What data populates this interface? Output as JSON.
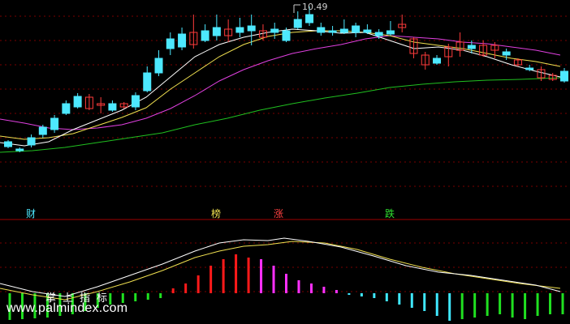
{
  "colors": {
    "background": "#000000",
    "grid": "#7a0000",
    "separator": "#a00000",
    "up": "#ff3b3b",
    "down": "#4de8ff",
    "ma5": "#ffffff",
    "ma10": "#f0e050",
    "ma20": "#e040e0",
    "ma60": "#20c020",
    "hist_red": "#ff1a1a",
    "hist_magenta": "#ff30ff",
    "hist_cyan": "#40e8ff",
    "hist_green": "#20e020"
  },
  "annotations": {
    "high_label": "10.49",
    "signal_cai": "财",
    "signal_bang": "榜",
    "signal_zhang": "涨",
    "signal_die": "跌",
    "indicator_name": "掌上指标",
    "watermark": "www.palmindex.com"
  },
  "chart_data": [
    {
      "type": "candlestick",
      "title": "",
      "high_marker": 10.49,
      "candles": [
        [
          175,
          181,
          173,
          183
        ],
        [
          184,
          186,
          182,
          188
        ],
        [
          170,
          179,
          166,
          182
        ],
        [
          157,
          166,
          154,
          170
        ],
        [
          146,
          160,
          142,
          164
        ],
        [
          128,
          140,
          124,
          142
        ],
        [
          119,
          132,
          115,
          134
        ],
        [
          134,
          120,
          116,
          136
        ],
        [
          130,
          128,
          120,
          140
        ],
        [
          128,
          136,
          124,
          138
        ],
        [
          132,
          128,
          126,
          134
        ],
        [
          118,
          132,
          114,
          136
        ],
        [
          90,
          112,
          82,
          114
        ],
        [
          72,
          90,
          62,
          94
        ],
        [
          48,
          60,
          40,
          68
        ],
        [
          42,
          58,
          34,
          62
        ],
        [
          55,
          40,
          18,
          60
        ],
        [
          38,
          50,
          30,
          52
        ],
        [
          34,
          44,
          18,
          50
        ],
        [
          44,
          36,
          24,
          52
        ],
        [
          34,
          40,
          22,
          46
        ],
        [
          32,
          38,
          18,
          56
        ],
        [
          46,
          38,
          30,
          50
        ],
        [
          36,
          40,
          28,
          48
        ],
        [
          38,
          50,
          34,
          52
        ],
        [
          24,
          34,
          14,
          36
        ],
        [
          18,
          28,
          8,
          32
        ],
        [
          34,
          40,
          28,
          44
        ],
        [
          38,
          40,
          32,
          44
        ],
        [
          36,
          40,
          24,
          42
        ],
        [
          32,
          40,
          28,
          46
        ],
        [
          37,
          40,
          30,
          42
        ],
        [
          40,
          44,
          36,
          48
        ],
        [
          38,
          42,
          26,
          44
        ],
        [
          34,
          30,
          18,
          40
        ],
        [
          66,
          48,
          46,
          72
        ],
        [
          80,
          68,
          64,
          86
        ],
        [
          72,
          78,
          68,
          80
        ],
        [
          70,
          58,
          54,
          82
        ],
        [
          62,
          52,
          40,
          70
        ],
        [
          56,
          60,
          50,
          66
        ],
        [
          68,
          56,
          50,
          70
        ],
        [
          62,
          56,
          52,
          72
        ],
        [
          64,
          68,
          60,
          74
        ],
        [
          80,
          74,
          72,
          82
        ],
        [
          84,
          86,
          80,
          88
        ],
        [
          96,
          86,
          82,
          100
        ],
        [
          98,
          93,
          90,
          100
        ],
        [
          88,
          100,
          84,
          102
        ]
      ],
      "ma5": [
        [
          0,
          176
        ],
        [
          30,
          180
        ],
        [
          60,
          175
        ],
        [
          90,
          160
        ],
        [
          120,
          148
        ],
        [
          150,
          136
        ],
        [
          180,
          120
        ],
        [
          210,
          95
        ],
        [
          240,
          70
        ],
        [
          270,
          55
        ],
        [
          300,
          46
        ],
        [
          330,
          40
        ],
        [
          360,
          36
        ],
        [
          390,
          38
        ],
        [
          420,
          41
        ],
        [
          450,
          40
        ],
        [
          480,
          50
        ],
        [
          510,
          60
        ],
        [
          540,
          58
        ],
        [
          570,
          62
        ],
        [
          600,
          70
        ],
        [
          630,
          80
        ],
        [
          660,
          88
        ],
        [
          690,
          95
        ]
      ],
      "ma10": [
        [
          0,
          168
        ],
        [
          30,
          172
        ],
        [
          60,
          170
        ],
        [
          90,
          165
        ],
        [
          120,
          155
        ],
        [
          150,
          145
        ],
        [
          180,
          133
        ],
        [
          210,
          110
        ],
        [
          240,
          90
        ],
        [
          270,
          70
        ],
        [
          300,
          55
        ],
        [
          330,
          45
        ],
        [
          360,
          40
        ],
        [
          390,
          38
        ],
        [
          420,
          38
        ],
        [
          450,
          40
        ],
        [
          480,
          44
        ],
        [
          510,
          52
        ],
        [
          540,
          56
        ],
        [
          570,
          60
        ],
        [
          600,
          66
        ],
        [
          630,
          72
        ],
        [
          660,
          76
        ],
        [
          690,
          82
        ]
      ],
      "ma20": [
        [
          0,
          147
        ],
        [
          30,
          152
        ],
        [
          60,
          158
        ],
        [
          90,
          160
        ],
        [
          120,
          158
        ],
        [
          150,
          154
        ],
        [
          180,
          146
        ],
        [
          210,
          134
        ],
        [
          240,
          118
        ],
        [
          270,
          100
        ],
        [
          300,
          86
        ],
        [
          330,
          75
        ],
        [
          360,
          66
        ],
        [
          390,
          60
        ],
        [
          420,
          55
        ],
        [
          450,
          48
        ],
        [
          480,
          44
        ],
        [
          510,
          46
        ],
        [
          540,
          48
        ],
        [
          570,
          52
        ],
        [
          600,
          54
        ],
        [
          630,
          58
        ],
        [
          660,
          62
        ],
        [
          690,
          68
        ]
      ],
      "ma60": [
        [
          0,
          188
        ],
        [
          40,
          186
        ],
        [
          80,
          182
        ],
        [
          120,
          176
        ],
        [
          160,
          170
        ],
        [
          200,
          164
        ],
        [
          240,
          154
        ],
        [
          280,
          146
        ],
        [
          320,
          136
        ],
        [
          360,
          128
        ],
        [
          400,
          121
        ],
        [
          440,
          115
        ],
        [
          480,
          108
        ],
        [
          520,
          104
        ],
        [
          560,
          101
        ],
        [
          600,
          99
        ],
        [
          640,
          98
        ],
        [
          690,
          96
        ]
      ],
      "signals": [
        "财",
        "榜",
        "涨",
        "跌"
      ]
    },
    {
      "type": "bar",
      "title": "掌上指标",
      "series": [
        {
          "values": [
            -33,
            -32,
            -31,
            -30,
            -28,
            -26,
            -22,
            -18,
            -14,
            -12,
            -10,
            -8,
            -6,
            6,
            12,
            22,
            34,
            42,
            48,
            44,
            42,
            34,
            24,
            16,
            12,
            8,
            4,
            -2,
            -4,
            -6,
            -10,
            -14,
            -18,
            -22,
            -28,
            -34,
            -32,
            -30,
            -28,
            -26,
            -30,
            -32,
            -28,
            -26,
            -26
          ]
        }
      ],
      "line_white": [
        [
          0,
          350
        ],
        [
          40,
          360
        ],
        [
          80,
          366
        ],
        [
          120,
          354
        ],
        [
          160,
          340
        ],
        [
          200,
          326
        ],
        [
          240,
          310
        ],
        [
          270,
          300
        ],
        [
          300,
          296
        ],
        [
          330,
          297
        ],
        [
          350,
          294
        ],
        [
          380,
          298
        ],
        [
          420,
          305
        ],
        [
          460,
          316
        ],
        [
          500,
          328
        ],
        [
          540,
          336
        ],
        [
          580,
          340
        ],
        [
          620,
          346
        ],
        [
          660,
          352
        ],
        [
          690,
          360
        ]
      ],
      "line_yellow": [
        [
          0,
          356
        ],
        [
          40,
          364
        ],
        [
          80,
          370
        ],
        [
          120,
          360
        ],
        [
          160,
          348
        ],
        [
          200,
          334
        ],
        [
          240,
          318
        ],
        [
          270,
          310
        ],
        [
          300,
          304
        ],
        [
          330,
          302
        ],
        [
          360,
          298
        ],
        [
          400,
          300
        ],
        [
          440,
          308
        ],
        [
          480,
          320
        ],
        [
          520,
          330
        ],
        [
          560,
          338
        ],
        [
          600,
          344
        ],
        [
          640,
          350
        ],
        [
          690,
          356
        ]
      ]
    }
  ]
}
